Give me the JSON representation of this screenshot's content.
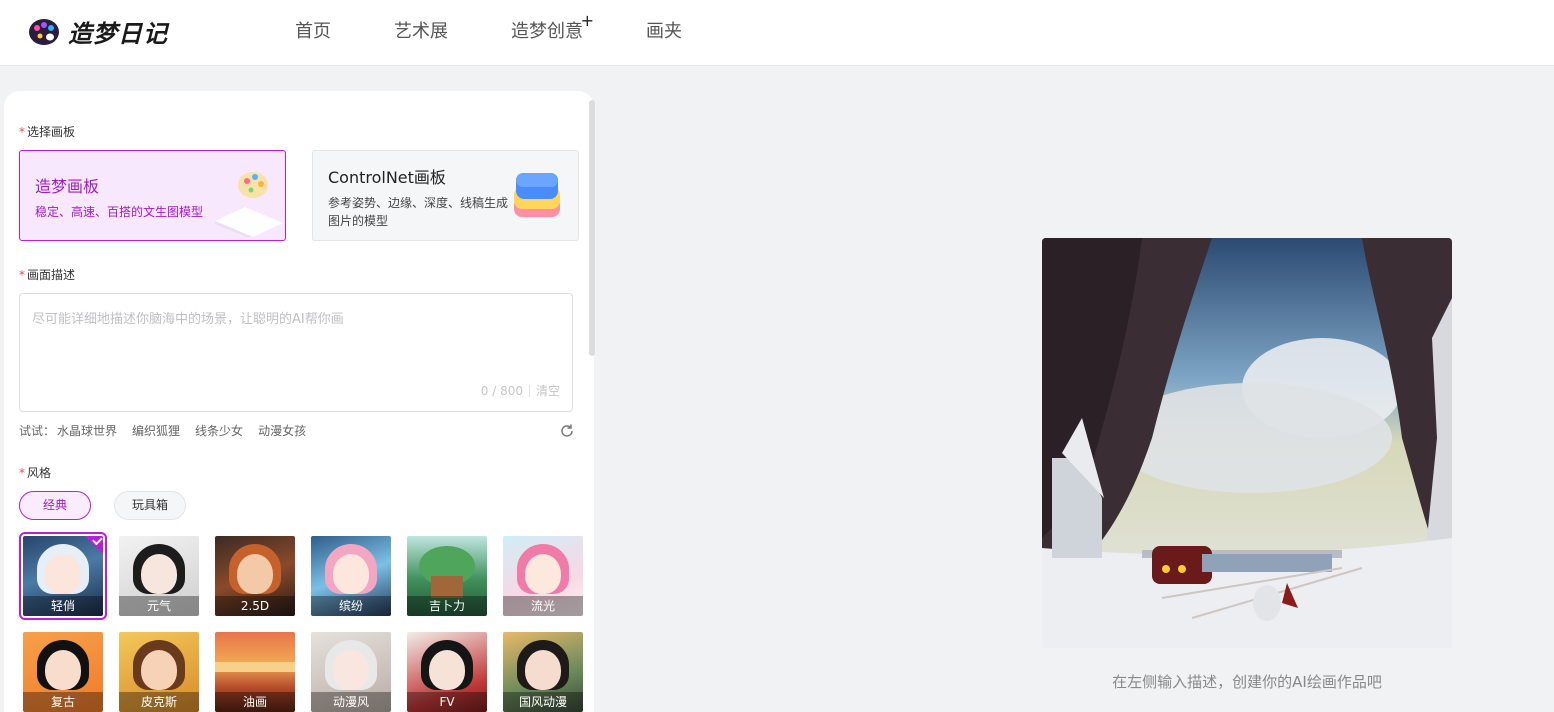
{
  "header": {
    "logo_text": "造梦日记",
    "nav": [
      {
        "label": "首页"
      },
      {
        "label": "艺术展"
      },
      {
        "label": "造梦创意",
        "badge": "+"
      },
      {
        "label": "画夹"
      }
    ]
  },
  "form": {
    "canvas_section": {
      "required_mark": "*",
      "label": "选择画板"
    },
    "boards": [
      {
        "title": "造梦画板",
        "desc": "稳定、高速、百搭的文生图模型",
        "selected": true
      },
      {
        "title": "ControlNet画板",
        "desc": "参考姿势、边缘、深度、线稿生成图片的模型",
        "selected": false
      }
    ],
    "prompt_section": {
      "required_mark": "*",
      "label": "画面描述"
    },
    "prompt": {
      "value": "",
      "placeholder": "尽可能详细地描述你脑海中的场景，让聪明的AI帮你画",
      "counter": "0 / 800",
      "clear_label": "清空"
    },
    "try": {
      "label": "试试：",
      "items": [
        "水晶球世界",
        "编织狐狸",
        "线条少女",
        "动漫女孩"
      ]
    },
    "style_section": {
      "required_mark": "*",
      "label": "风格"
    },
    "style_tabs": [
      {
        "label": "经典",
        "active": true
      },
      {
        "label": "玩具箱",
        "active": false
      }
    ],
    "styles": [
      {
        "label": "轻俏",
        "selected": true
      },
      {
        "label": "元气"
      },
      {
        "label": "2.5D"
      },
      {
        "label": "缤纷"
      },
      {
        "label": "吉卜力"
      },
      {
        "label": "流光"
      },
      {
        "label": "复古"
      },
      {
        "label": "皮克斯"
      },
      {
        "label": "油画"
      },
      {
        "label": "动漫风"
      },
      {
        "label": "FV"
      },
      {
        "label": "国风动漫"
      }
    ]
  },
  "preview": {
    "hint": "在左侧输入描述，创建你的AI绘画作品吧"
  },
  "colors": {
    "accent": "#b620d8",
    "accent_text": "#a11bc4",
    "accent_bg": "#f7e8fd",
    "page_bg": "#f1f2f4"
  }
}
